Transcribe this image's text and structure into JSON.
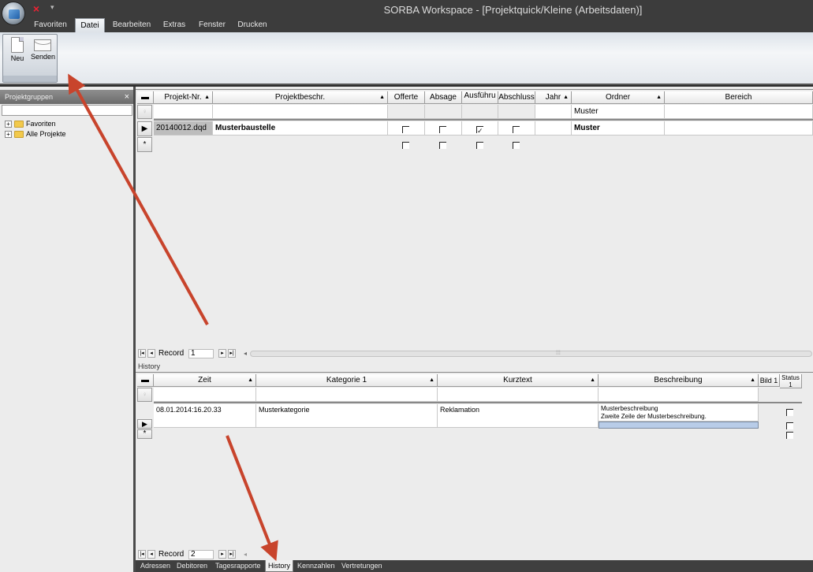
{
  "window": {
    "title": "SORBA Workspace - [Projektquick/Kleine (Arbeitsdaten)]"
  },
  "quick_access": {
    "close_icon": "×",
    "dropdown_icon": "▾"
  },
  "ribbon_tabs": [
    "Favoriten",
    "Datei",
    "Bearbeiten",
    "Extras",
    "Fenster",
    "Drucken"
  ],
  "ribbon_active_tab": "Datei",
  "ribbon_buttons": {
    "neu": "Neu",
    "senden": "Senden"
  },
  "left_panel": {
    "title": "Projektgruppen",
    "close": "×",
    "tree": [
      {
        "expander": "+",
        "label": "Favoriten"
      },
      {
        "expander": "+",
        "label": "Alle Projekte"
      }
    ]
  },
  "projects_grid": {
    "columns": {
      "projekt_nr": "Projekt-Nr.",
      "projektbeschr": "Projektbeschr.",
      "offerte": "Offerte",
      "absage": "Absage",
      "ausfuehru": "Ausführu",
      "abschluss": "Abschluss",
      "jahr": "Jahr",
      "ordner": "Ordner",
      "bereich": "Bereich"
    },
    "filter": {
      "ordner": "Muster"
    },
    "rows": [
      {
        "projekt_nr": "20140012.dqd",
        "projektbeschr": "Musterbaustelle",
        "offerte": false,
        "absage": false,
        "ausfuehru": true,
        "abschluss": false,
        "ordner": "Muster"
      }
    ],
    "new_row_marker": "*",
    "record_label": "Record",
    "record_value": "1",
    "scroll_grip": "⁞⁞⁞"
  },
  "history": {
    "section_label": "History",
    "columns": {
      "zeit": "Zeit",
      "kategorie": "Kategorie 1",
      "kurztext": "Kurztext",
      "beschreibung": "Beschreibung",
      "bild": "Bild 1",
      "status": "Status 1"
    },
    "rows": [
      {
        "zeit": "08.01.2014:16.20.33",
        "kategorie": "Musterkategorie",
        "kurztext": "Reklamation",
        "beschreibung_line1": "Musterbeschreibung",
        "beschreibung_line2": " Zweite Zeile der Musterbeschreibung."
      }
    ],
    "new_row_marker": "*",
    "record_label": "Record",
    "record_value": "2"
  },
  "bottom_tabs": [
    "Adressen",
    "Debitoren",
    "Tagesrapporte",
    "History",
    "Kennzahlen",
    "Vertretungen"
  ],
  "bottom_active_tab": "History",
  "colors": {
    "annotation_arrow": "#c8442c",
    "dark_chrome": "#3c3c3c",
    "selected_cell": "#b8cce8"
  }
}
